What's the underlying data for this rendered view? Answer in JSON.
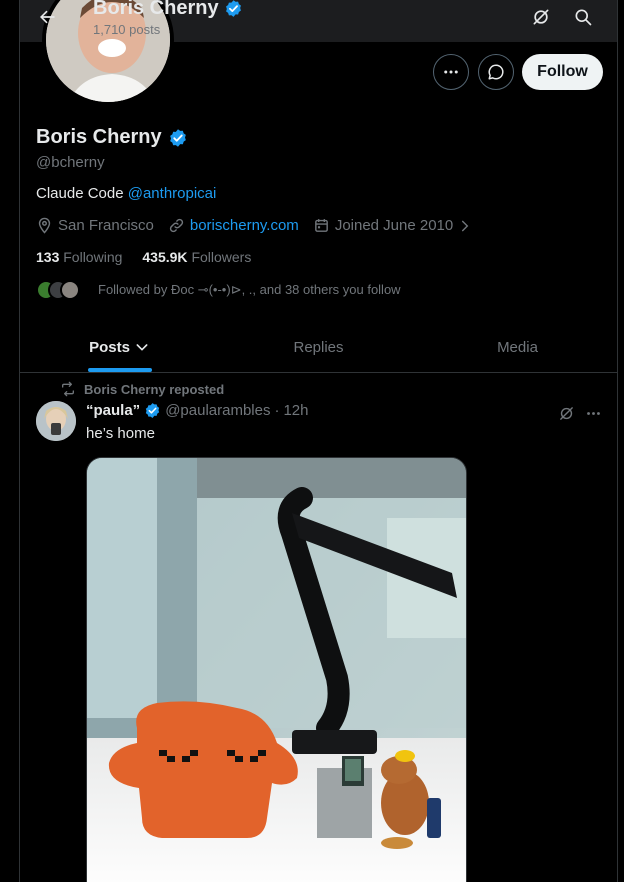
{
  "header": {
    "name": "Boris Cherny",
    "posts_count": "1,710 posts"
  },
  "actions": {
    "follow_label": "Follow"
  },
  "profile": {
    "name": "Boris Cherny",
    "handle": "@bcherny",
    "bio_text": "Claude Code ",
    "bio_mention": "@anthropicai",
    "location": "San Francisco",
    "website": "borischerny.com",
    "joined": "Joined June 2010",
    "following_count": "133",
    "following_label": "Following",
    "followers_count": "435.9K",
    "followers_label": "Followers",
    "followed_by": "Followed by Đoc ⊸(•-•)⊳, ., and 38 others you follow"
  },
  "tabs": [
    {
      "label": "Posts"
    },
    {
      "label": "Replies"
    },
    {
      "label": "Media"
    }
  ],
  "post": {
    "repost_label": "Boris Cherny reposted",
    "display_name": "“paula”",
    "handle": "@paularambles",
    "separator": "·",
    "time": "12h",
    "text": "he’s home"
  },
  "colors": {
    "accent": "#1d9bf0",
    "background": "#000000",
    "secondary_text": "#71767b"
  }
}
